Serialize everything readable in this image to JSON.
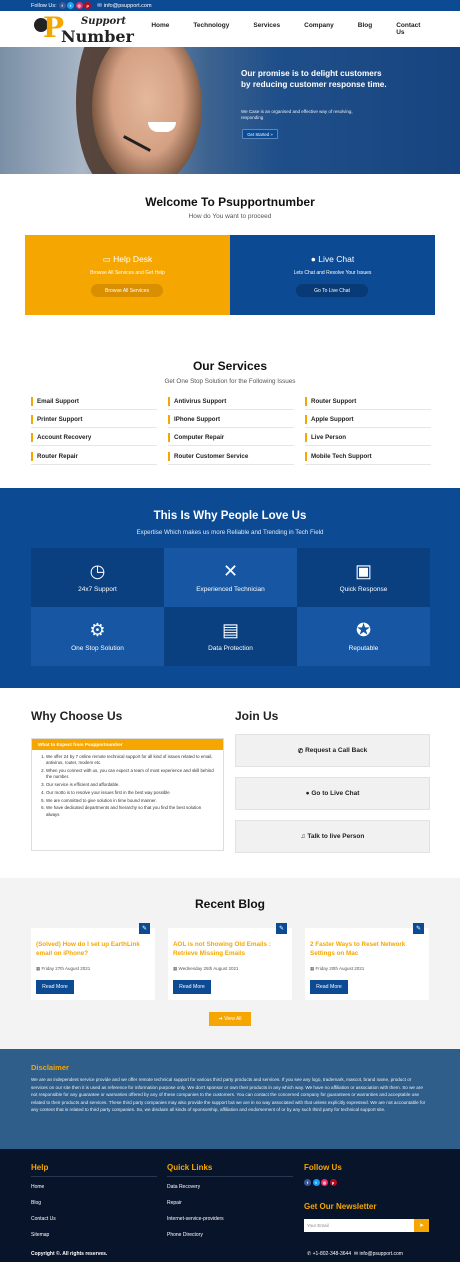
{
  "topbar": {
    "follow_label": "Follow Us",
    "email": "info@psupport.com"
  },
  "brand": {
    "logo_letter": "P",
    "logo_top": "Support",
    "logo_bottom": "Number"
  },
  "nav": {
    "items": [
      "Home",
      "Technology",
      "Services",
      "Company",
      "Blog",
      "Contact Us"
    ]
  },
  "hero": {
    "headline": "Our promise is to delight customers by reducing customer response time.",
    "subtext": "We Case is an organised and effective way of resolving, responding",
    "button": "Get Started »"
  },
  "welcome": {
    "title": "Welcome To Psupportnumber",
    "subtitle": "How do You want to proceed",
    "helpdesk": {
      "title": "Help Desk",
      "desc": "Browse All Services and Get Help",
      "button": "Browse All Services"
    },
    "livechat": {
      "title": "Live Chat",
      "desc": "Lets Chat and Resolve Your Issues",
      "button": "Go To Live Chat"
    }
  },
  "services": {
    "title": "Our Services",
    "subtitle": "Get One Stop Solution for the Following Issues",
    "items": [
      "Email Support",
      "Antivirus Support",
      "Router Support",
      "Printer Support",
      "IPhone Support",
      "Apple Support",
      "Account Recovery",
      "Computer Repair",
      "Live Person",
      "Router Repair",
      "Router Customer Service",
      "Mobile Tech Support"
    ]
  },
  "why": {
    "title": "This Is Why People Love Us",
    "subtitle": "Expertise Which makes us more Reliable and Trending in Tech Field",
    "tiles": [
      "24x7 Support",
      "Experienced Technician",
      "Quick Response",
      "One Stop Solution",
      "Data Protection",
      "Reputable"
    ]
  },
  "choose": {
    "title": "Why Choose Us",
    "box_header": "What to Expect from Psupportnumber",
    "points": [
      "We offer 24 by 7 online remote technical support for all kind of issues related to email, antivirus, router, modem etc.",
      "When you connect with us, you can expect a team of most experience and skill behind the number.",
      "Our service is efficient and affordable.",
      "Our motto is to resolve your issues first in the best way possible",
      "We are committed to give solution in time bound manner.",
      "We have dedicated departments and hierarchy so that you find the best solution always"
    ]
  },
  "join": {
    "title": "Join Us",
    "buttons": [
      "Request a Call Back",
      "Go to Live Chat",
      "Talk to live Person"
    ]
  },
  "blog": {
    "title": "Recent Blog",
    "read_more": "Read More",
    "view_all": "View All",
    "posts": [
      {
        "title": "(Solved) How do I set up EarthLink email on iPhone?",
        "date": "Friday 27th August 2021"
      },
      {
        "title": "AOL is not Showing Old Emails : Retrieve Missing Emails",
        "date": "Wednesday 25th August 2021"
      },
      {
        "title": "2 Faster Ways to Reset Network Settings on Mac",
        "date": "Friday 20th August 2021"
      }
    ]
  },
  "disclaimer": {
    "title": "Disclaimer",
    "text": "We are an independent service provide and we offer remote technical support for various third party products and services. If you see any logo, trademark, mascot, brand name, product or services on our site then it is used as reference for information purpose only. We don't sponsor or own their products in any which way. We have no affiliation or association with them. So we are not responsible for any guarantee or warranties offered by any of these companies to the customers. You can contact the concerned company for guarantees or warranties and acceptable use related to their products and services. These third party companies may also provide the support but we are in no way associated with that unless explicitly expressed. We are not accountable for any content that is related to third party companies. So, we disclaim all kinds of sponsorship, affiliation and endorsement of or by any such third party for technical support site."
  },
  "footer": {
    "help_title": "Help",
    "help_links": [
      "Home",
      "Blog",
      "Contact Us",
      "Sitemap"
    ],
    "quick_title": "Quick Links",
    "quick_links": [
      "Data Recovery",
      "Repair",
      "Internet-service-providers",
      "Phone Directory"
    ],
    "follow_title": "Follow Us",
    "newsletter_title": "Get Our Newsletter",
    "email_placeholder": "Your Email",
    "copyright": "Copyright ©. All rights reserves.",
    "phone": "+1-802-348-3644",
    "email": "info@psupport.com"
  },
  "colors": {
    "brand_blue": "#0c4a93",
    "accent_orange": "#f6a600",
    "footer_dark": "#07142a",
    "disclaimer_blue": "#305e8a"
  }
}
